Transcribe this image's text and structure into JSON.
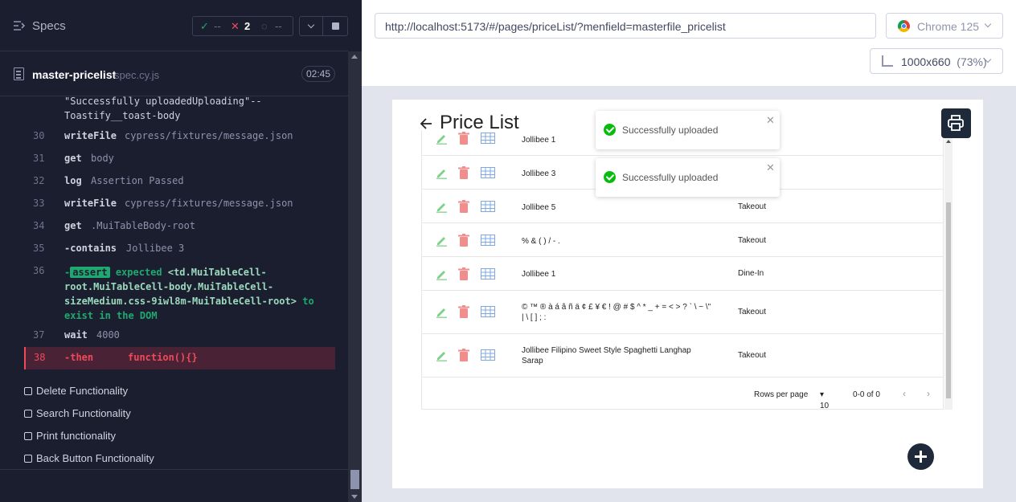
{
  "runner": {
    "specs_title": "Specs",
    "stats": {
      "passed": "--",
      "failed": "2",
      "pending": "--"
    },
    "spec_file": {
      "name": "master-pricelist",
      "ext": "spec.cy.js",
      "duration": "02:45"
    },
    "commands": [
      {
        "num": "",
        "name": "",
        "msg": "\"Successfully uploadedUploading\"--Toastify__toast-body"
      },
      {
        "num": "30",
        "name": "writeFile",
        "msg": "cypress/fixtures/message.json"
      },
      {
        "num": "31",
        "name": "get",
        "msg": "body"
      },
      {
        "num": "32",
        "name": "log",
        "msg": "Assertion Passed"
      },
      {
        "num": "33",
        "name": "writeFile",
        "msg": "cypress/fixtures/message.json"
      },
      {
        "num": "34",
        "name": "get",
        "msg": ".MuiTableBody-root"
      },
      {
        "num": "35",
        "name": "-contains",
        "msg": "Jollibee 3"
      },
      {
        "num": "36",
        "name": "-assert",
        "msg": "expected <td.MuiTableCell-root.MuiTableCell-body.MuiTableCell-sizeMedium.css-9iwl8m-MuiTableCell-root> to exist in the DOM"
      },
      {
        "num": "37",
        "name": "wait",
        "msg": "4000"
      },
      {
        "num": "38",
        "name": "-then",
        "msg": "function(){}"
      }
    ],
    "assert": {
      "prefix": "-",
      "badge": "assert",
      "expected": "expected",
      "element": "<td.MuiTableCell-root.MuiTableCell-body.MuiTableCell-sizeMedium.css-9iwl8m-MuiTableCell-root>",
      "element_lines": [
        "<td.MuiTableCell-",
        "root.MuiTableCell-body.MuiTableCell-",
        "sizeMedium.css-9iwl8m-MuiTableCell-root>"
      ],
      "tail": "to",
      "tail2": "exist in the DOM"
    },
    "continuation_lines": [
      "\"Successfully uploadedUploading\"--",
      "Toastify__toast-body"
    ],
    "tests": [
      "Delete Functionality",
      "Search Functionality",
      "Print functionality",
      "Back Button Functionality"
    ]
  },
  "browser": {
    "url": "http://localhost:5173/#/pages/priceList/?menfield=masterfile_pricelist",
    "name": "Chrome 125",
    "viewport": "1000x660",
    "zoom": "(73%)"
  },
  "app": {
    "title": "Price List",
    "toasts": [
      "Successfully uploaded",
      "Successfully uploaded"
    ],
    "rows": [
      {
        "name": "Jollibee 1",
        "type": ""
      },
      {
        "name": "Jollibee 3",
        "type": ""
      },
      {
        "name": "Jollibee 5",
        "type": "Takeout"
      },
      {
        "name": "% & ( ) / - .",
        "type": "Takeout"
      },
      {
        "name": "Jollibee 1",
        "type": "Dine-In"
      },
      {
        "name": "© ™ ® à á â ñ ä ¢ £ ¥ € ! @ # $ ^ * _ + = < > ? ` \\ ~ \\\" | \\ [ ] ; :",
        "type": "Takeout"
      },
      {
        "name": "Jollibee Filipino Sweet Style Spaghetti Langhap Sarap",
        "type": "Takeout"
      }
    ],
    "pager": {
      "label": "Rows per page",
      "per_page": "10",
      "range": "0-0 of 0"
    }
  },
  "colors": {
    "pass": "#1fa971",
    "fail": "#ee4a5a",
    "panel_bg": "#1b1e2e",
    "app_dark": "#1e2a3a"
  }
}
